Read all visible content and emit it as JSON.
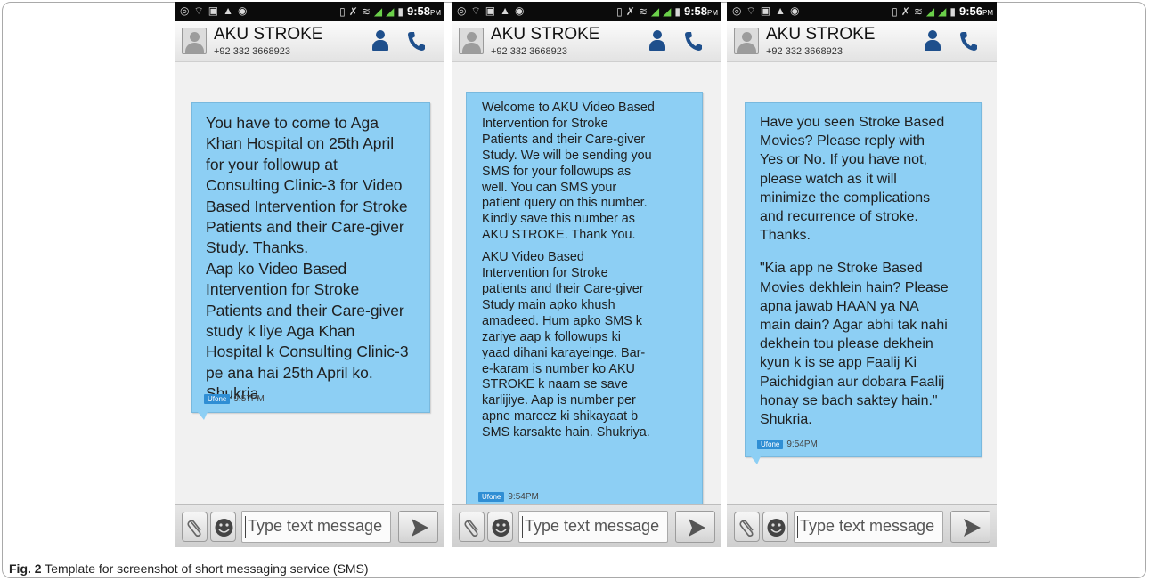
{
  "caption": {
    "label": "Fig. 2",
    "text": "Template for screenshot of short messaging service (SMS)"
  },
  "colors": {
    "bubble": "#8dcff4",
    "header_icon": "#1e4f8c",
    "carrier_badge": "#2f8ed4",
    "status_bar": "#0b0b0b"
  },
  "phones": [
    {
      "status_time": "9:58",
      "status_ampm": "PM",
      "contact_name": "AKU STROKE",
      "contact_number": "+92 332 3668923",
      "message_paragraphs": [
        "You have to come to Aga\nKhan Hospital on 25th April\nfor your followup at\nConsulting Clinic-3 for Video\nBased Intervention for Stroke\nPatients and their Care-giver\nStudy. Thanks.\nAap ko Video Based\nIntervention for Stroke\nPatients and their Care-giver\nstudy k liye Aga Khan\nHospital k Consulting Clinic-3\npe ana hai 25th April ko.\nShukria"
      ],
      "carrier": "Ufone",
      "message_time": "9:57PM",
      "input_placeholder": "Type text message"
    },
    {
      "status_time": "9:58",
      "status_ampm": "PM",
      "contact_name": "AKU STROKE",
      "contact_number": "+92 332 3668923",
      "message_paragraphs": [
        "Welcome to AKU Video Based\nIntervention for Stroke\nPatients and their Care-giver\nStudy. We will be sending you\nSMS for your followups as\nwell. You can SMS your\npatient query on this number.\nKindly save this number as\nAKU STROKE. Thank You.",
        "AKU Video Based\nIntervention for Stroke\npatients and their Care-giver\nStudy main apko khush\namadeed. Hum apko SMS k\nzariye aap k followups ki\nyaad dihani karayeinge. Bar-\ne-karam is number ko AKU\nSTROKE k naam se save\nkarlijiye. Aap is number per\napne mareez ki shikayaat b\nSMS karsakte hain. Shukriya."
      ],
      "carrier": "Ufone",
      "message_time": "9:54PM",
      "input_placeholder": "Type text message"
    },
    {
      "status_time": "9:56",
      "status_ampm": "PM",
      "contact_name": "AKU STROKE",
      "contact_number": "+92 332 3668923",
      "message_paragraphs": [
        "Have you seen Stroke Based\nMovies? Please reply with\nYes or No. If you have not,\nplease watch as it will\nminimize the complications\nand recurrence of stroke.\nThanks.",
        "\"Kia app ne Stroke Based\nMovies dekhlein hain? Please\napna jawab HAAN ya NA\nmain dain? Agar abhi tak nahi\ndekhein tou please dekhein\nkyun k is se app Faalij Ki\nPaichidgian aur dobara Faalij\nhonay se bach saktey hain.\"\nShukria."
      ],
      "carrier": "Ufone",
      "message_time": "9:54PM",
      "input_placeholder": "Type text message"
    }
  ]
}
